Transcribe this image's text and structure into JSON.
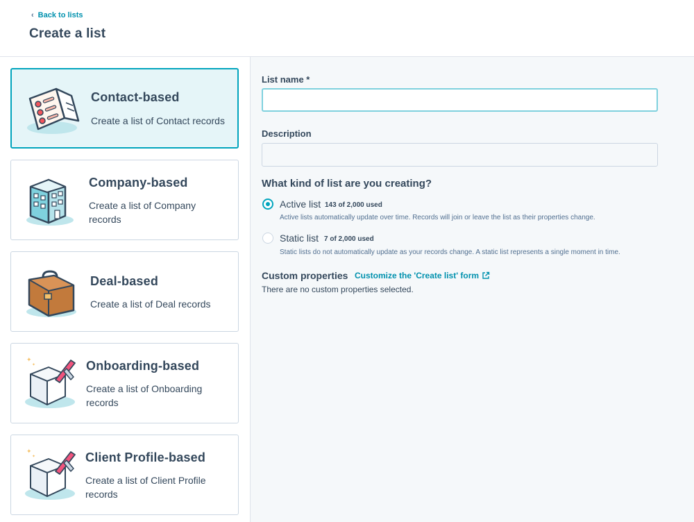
{
  "header": {
    "back_label": "Back to lists",
    "title": "Create a list"
  },
  "list_types": [
    {
      "title": "Contact-based",
      "desc": "Create a list of Contact records",
      "icon": "contacts-card-icon",
      "selected": true
    },
    {
      "title": "Company-based",
      "desc": "Create a list of Company records",
      "icon": "building-icon",
      "selected": false
    },
    {
      "title": "Deal-based",
      "desc": "Create a list of Deal records",
      "icon": "briefcase-icon",
      "selected": false
    },
    {
      "title": "Onboarding-based",
      "desc": "Create a list of Onboarding records",
      "icon": "custom-object-cube-icon",
      "selected": false
    },
    {
      "title": "Client Profile-based",
      "desc": "Create a list of Client Profile records",
      "icon": "custom-object-cube-icon",
      "selected": false
    }
  ],
  "form": {
    "name_label": "List name *",
    "name_value": "",
    "description_label": "Description",
    "description_value": "",
    "kind_title": "What kind of list are you creating?",
    "options": [
      {
        "name": "Active list",
        "count": "143 of 2,000 used",
        "help": "Active lists automatically update over time. Records will join or leave the list as their properties change.",
        "checked": true
      },
      {
        "name": "Static list",
        "count": "7 of 2,000 used",
        "help": "Static lists do not automatically update as your records change. A static list represents a single moment in time.",
        "checked": false
      }
    ],
    "custom_label": "Custom properties",
    "custom_link": "Customize the 'Create list' form",
    "custom_none": "There are no custom properties selected."
  },
  "colors": {
    "accent": "#00a4bd",
    "link": "#0091ae",
    "text": "#33475b",
    "selected_bg": "#e5f5f8"
  }
}
